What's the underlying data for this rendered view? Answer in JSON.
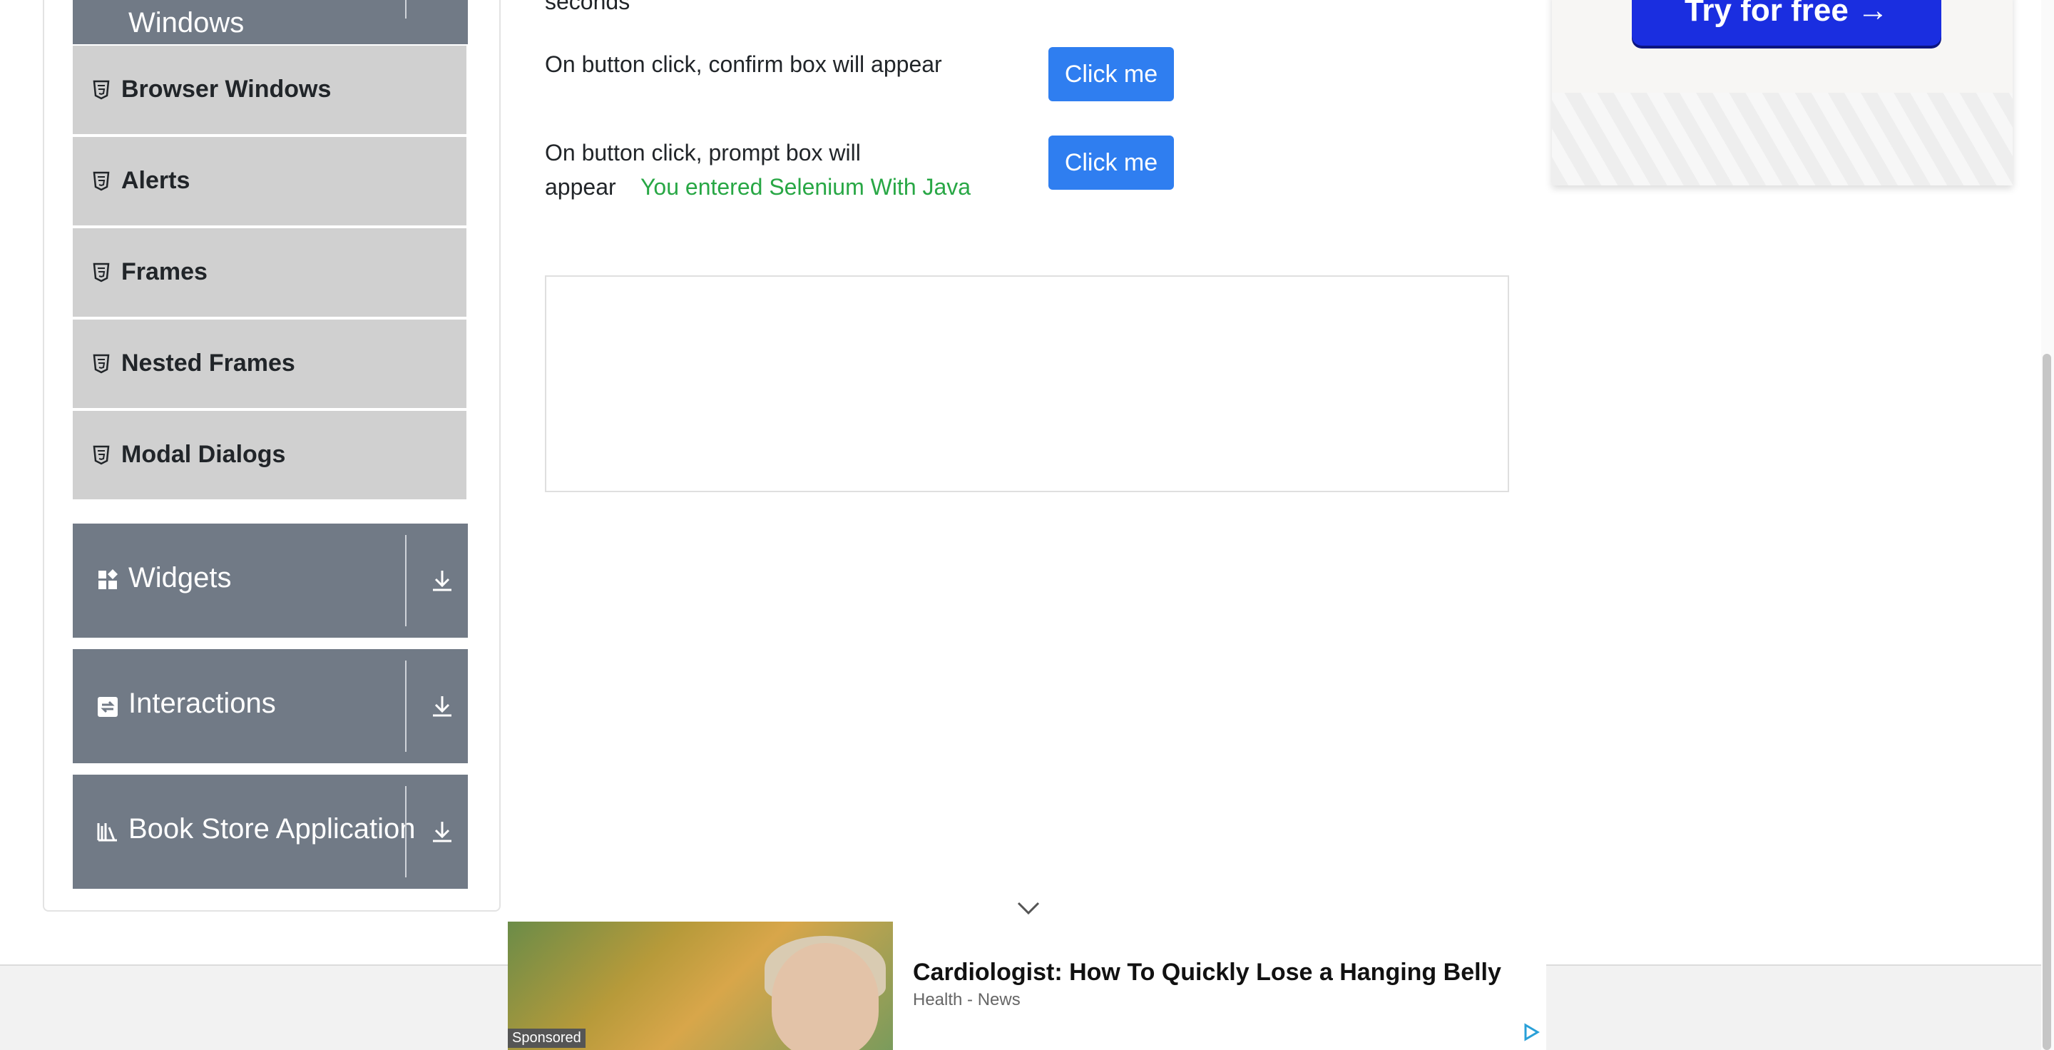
{
  "sidebar": {
    "top_group_label": "Windows",
    "items": [
      {
        "label": "Browser Windows",
        "icon": "html5-icon"
      },
      {
        "label": "Alerts",
        "icon": "html5-icon"
      },
      {
        "label": "Frames",
        "icon": "html5-icon"
      },
      {
        "label": "Nested Frames",
        "icon": "html5-icon"
      },
      {
        "label": "Modal Dialogs",
        "icon": "html5-icon"
      }
    ],
    "groups": [
      {
        "label": "Widgets",
        "icon": "widgets-icon"
      },
      {
        "label": "Interactions",
        "icon": "interactions-icon"
      },
      {
        "label": "Book Store Application",
        "icon": "library-icon"
      }
    ]
  },
  "main": {
    "partial_text": "seconds",
    "confirm_row": {
      "text": "On button click, confirm box will appear",
      "button_label": "Click me"
    },
    "prompt_row": {
      "text_line1": "On button click, prompt box will",
      "text_line2": "appear",
      "result": "You entered Selenium With Java",
      "button_label": "Click me"
    }
  },
  "ad_top": {
    "cta": "Try for free →"
  },
  "ad_bottom": {
    "sponsored_label": "Sponsored",
    "headline": "Cardiologist: How To Quickly Lose a Hanging Belly",
    "source": "Health - News"
  },
  "colors": {
    "accent": "#2f7ef0",
    "success_text": "#28a745",
    "group_header_bg": "#717a86",
    "menu_item_bg": "#d0d0d0",
    "ad_cta_bg": "#1a2ee0"
  }
}
